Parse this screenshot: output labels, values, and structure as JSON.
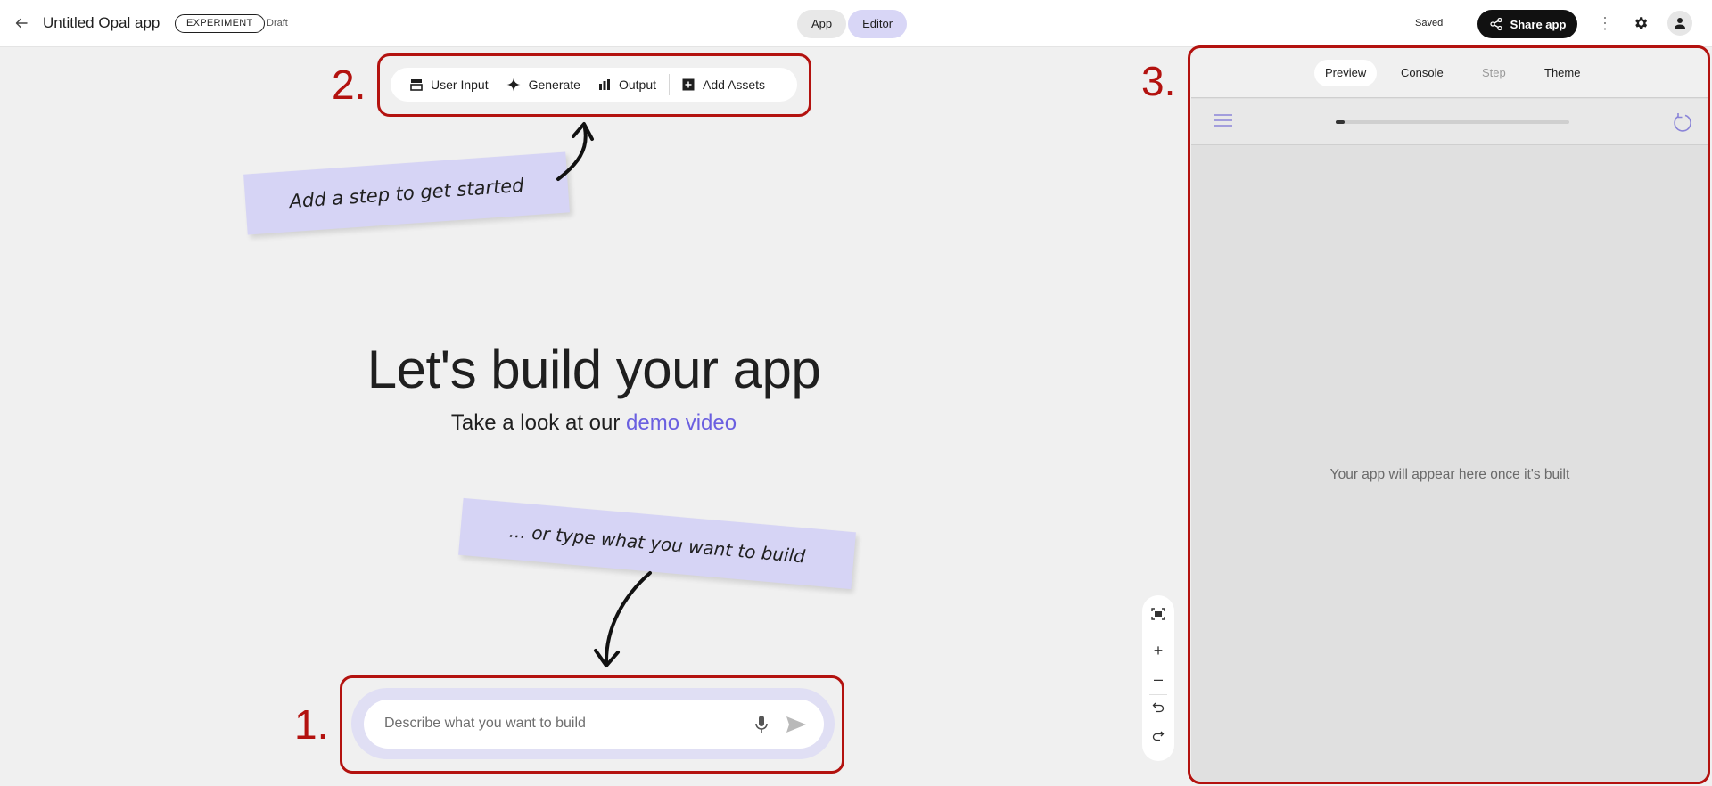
{
  "header": {
    "title": "Untitled Opal app",
    "badge": "EXPERIMENT",
    "status": "Draft",
    "modes": [
      {
        "label": "App",
        "active": false
      },
      {
        "label": "Editor",
        "active": true
      }
    ],
    "saved_label": "Saved",
    "share_label": "Share app"
  },
  "toolbar": {
    "items": [
      {
        "label": "User Input",
        "icon": "user-input-icon"
      },
      {
        "label": "Generate",
        "icon": "sparkle-icon"
      },
      {
        "label": "Output",
        "icon": "bar-chart-icon"
      },
      {
        "label": "Add Assets",
        "icon": "add-box-icon"
      }
    ]
  },
  "notes": {
    "step_hint": "Add a step to get started",
    "type_hint": "... or type what you want to build"
  },
  "hero": {
    "title": "Let's build your app",
    "subtitle": "Take a look at our ",
    "link": "demo video"
  },
  "prompt": {
    "placeholder": "Describe what you want to build"
  },
  "annotations": {
    "one": "1.",
    "two": "2.",
    "three": "3."
  },
  "preview_panel": {
    "tabs": [
      {
        "label": "Preview",
        "state": "active"
      },
      {
        "label": "Console",
        "state": "normal"
      },
      {
        "label": "Step",
        "state": "disabled"
      },
      {
        "label": "Theme",
        "state": "normal"
      }
    ],
    "progress": 0.01,
    "empty_message": "Your app will appear here once it's built"
  },
  "colors": {
    "accent": "#6a5fe0",
    "annotation_red": "#b3120f",
    "note_bg": "#d6d4f5"
  }
}
